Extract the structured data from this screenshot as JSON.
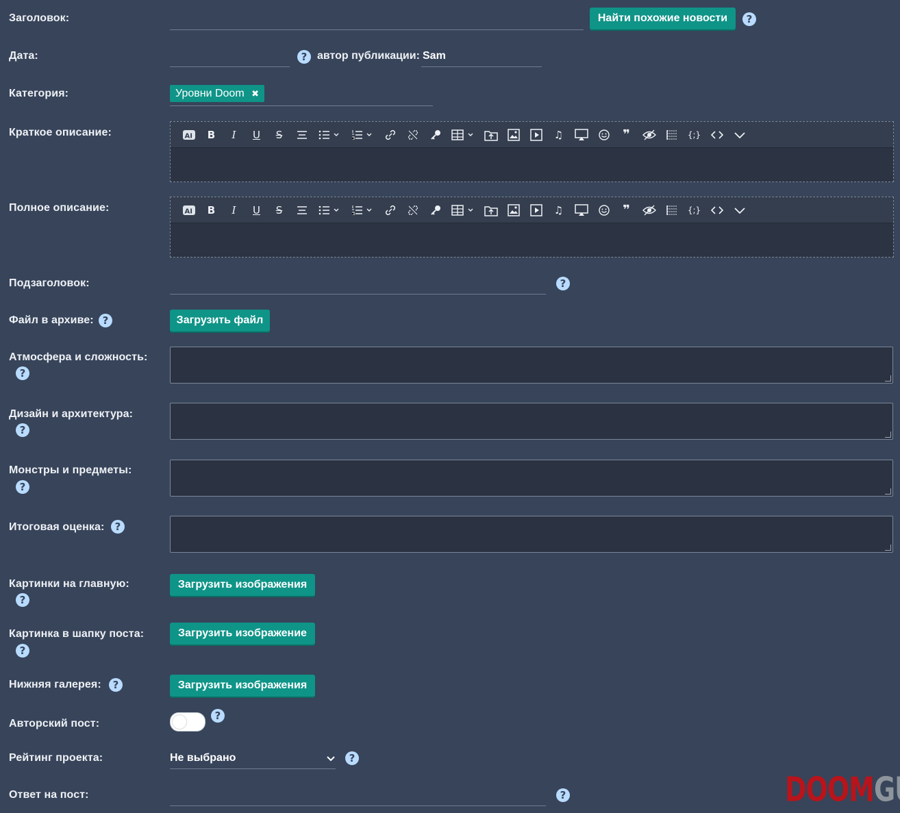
{
  "fields": {
    "title": {
      "label": "Заголовок:",
      "value": "",
      "button": "Найти похожие новости"
    },
    "date": {
      "label": "Дата:",
      "value": "",
      "author_label": "автор публикации:",
      "author_value": "Sam"
    },
    "category": {
      "label": "Категория:",
      "tag": "Уровни Doom",
      "tag_remove": "✖"
    },
    "short_desc": {
      "label": "Краткое описание:"
    },
    "full_desc": {
      "label": "Полное описание:"
    },
    "subtitle": {
      "label": "Подзаголовок:",
      "value": ""
    },
    "archive": {
      "label": "Файл в архиве:",
      "button": "Загрузить файл"
    },
    "atmosphere": {
      "label": "Атмосфера и сложность:"
    },
    "design": {
      "label": "Дизайн и архитектура:"
    },
    "monsters": {
      "label": "Монстры и предметы:"
    },
    "final": {
      "label": "Итоговая оценка:"
    },
    "main_images": {
      "label": "Картинки на главную:",
      "button": "Загрузить изображения"
    },
    "header_image": {
      "label": "Картинка в шапку поста:",
      "button": "Загрузить изображение"
    },
    "gallery": {
      "label": "Нижняя галерея:",
      "button": "Загрузить изображения"
    },
    "author_post": {
      "label": "Авторский пост:",
      "enabled": false
    },
    "rating": {
      "label": "Рейтинг проекта:",
      "selected": "Не выбрано"
    },
    "reply": {
      "label": "Ответ на пост:",
      "value": ""
    }
  },
  "help_glyph": "?",
  "editor_toolbar": [
    "ai-icon",
    "bold-icon",
    "italic-icon",
    "underline-icon",
    "strikethrough-icon",
    "align-icon",
    "bullet-list-icon",
    "numbered-list-icon",
    "link-icon",
    "unlink-icon",
    "key-icon",
    "table-icon",
    "upload-icon",
    "image-icon",
    "video-icon",
    "audio-icon",
    "media-icon",
    "emoji-icon",
    "quote-icon",
    "hide-icon",
    "page-break-icon",
    "code-braces-icon",
    "source-code-icon",
    "more-icon"
  ],
  "logo": {
    "part1": "DOOM",
    "part2": "GUY"
  },
  "colors": {
    "background": "#37445a",
    "accent": "#0f9488",
    "help": "#b9dbff",
    "logo_red": "#b8141b"
  }
}
